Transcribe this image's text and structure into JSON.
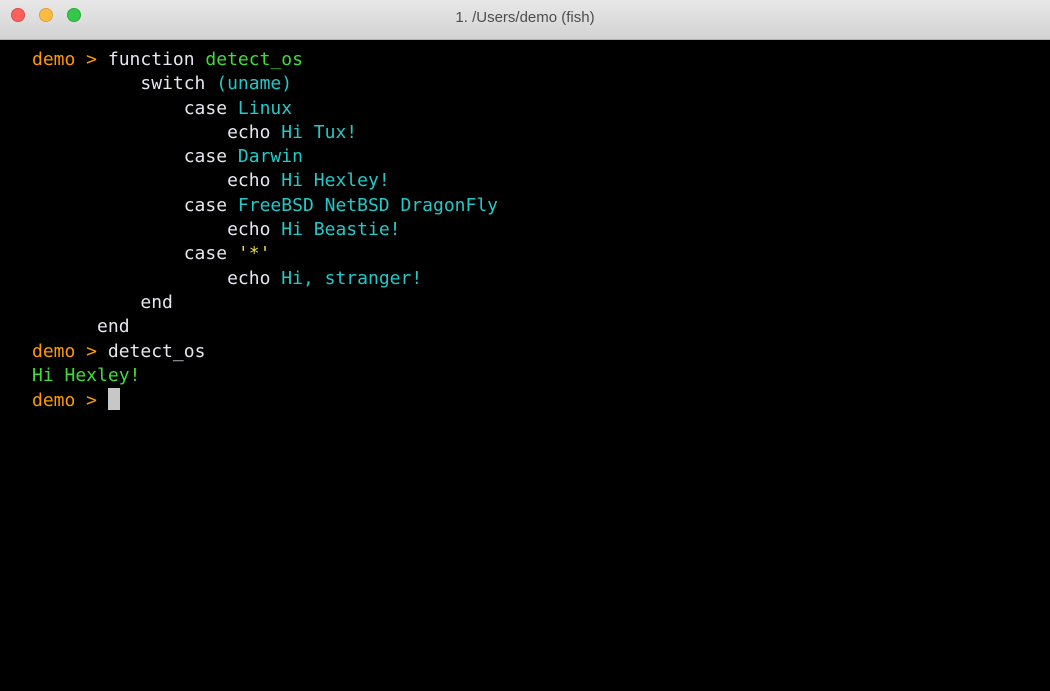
{
  "window": {
    "title": "1. /Users/demo (fish)"
  },
  "terminal": {
    "prompt": "demo >",
    "lines": [
      {
        "indent": "",
        "prompt": "demo >",
        "kw": "function",
        "arg": "detect_os"
      },
      {
        "indent": "          ",
        "kw": "switch",
        "arg": "(uname)"
      },
      {
        "indent": "              ",
        "kw": "case",
        "arg": "Linux"
      },
      {
        "indent": "                  ",
        "kw": "echo",
        "arg": "Hi Tux!"
      },
      {
        "indent": "              ",
        "kw": "case",
        "arg": "Darwin"
      },
      {
        "indent": "                  ",
        "kw": "echo",
        "arg": "Hi Hexley!"
      },
      {
        "indent": "              ",
        "kw": "case",
        "arg": "FreeBSD NetBSD DragonFly"
      },
      {
        "indent": "                  ",
        "kw": "echo",
        "arg": "Hi Beastie!"
      },
      {
        "indent": "              ",
        "kw": "case",
        "arg": "'*'"
      },
      {
        "indent": "                  ",
        "kw": "echo",
        "arg": "Hi, stranger!"
      },
      {
        "indent": "          ",
        "kw": "end"
      },
      {
        "indent": "      ",
        "kw": "end"
      },
      {
        "prompt": "demo >",
        "cmd": "detect_os"
      },
      {
        "output": "Hi Hexley!"
      },
      {
        "prompt": "demo >"
      }
    ]
  },
  "colors": {
    "prompt": "#ff9a00",
    "function_name": "#3fdc3b",
    "argument": "#22c9c9",
    "quoted_string": "#e8d94a",
    "output": "#3fdc3b",
    "keyword": "#e6e6f0",
    "background": "#000000"
  }
}
